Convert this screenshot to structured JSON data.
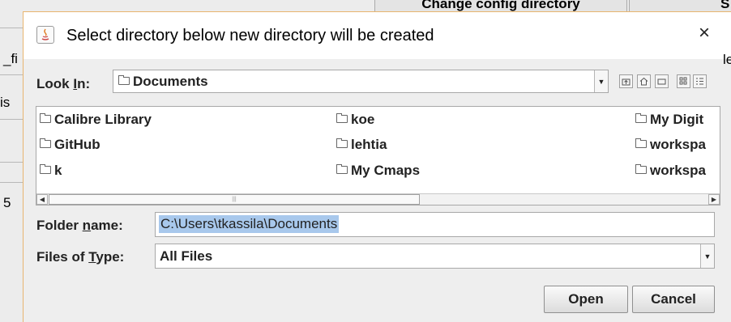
{
  "background": {
    "top_button_label": "Change config directory",
    "top_right_text": "S",
    "left_fragments": [
      "_fi",
      "is",
      "5"
    ],
    "right_fragments": [
      "le",
      "e"
    ]
  },
  "dialog": {
    "title": "Select directory below new directory will be created",
    "close_glyph": "×",
    "look_in_label_pre": "Look ",
    "look_in_label_mnemonic": "I",
    "look_in_label_post": "n:",
    "look_in_value": "Documents",
    "toolbar_icons": [
      "up-one-level-icon",
      "home-icon",
      "new-folder-icon",
      "list-view-icon",
      "details-view-icon"
    ],
    "files": [
      "Calibre Library",
      "GitHub",
      "k",
      "koe",
      "lehtia",
      "My Cmaps",
      "My Digit",
      "workspa",
      "workspa"
    ],
    "folder_name_label_pre": "Folder ",
    "folder_name_label_mnemonic": "n",
    "folder_name_label_post": "ame:",
    "folder_name_value": "C:\\Users\\tkassila\\Documents",
    "files_of_type_label_pre": "Files of ",
    "files_of_type_label_mnemonic": "T",
    "files_of_type_label_post": "ype:",
    "files_of_type_value": "All Files",
    "open_label": "Open",
    "cancel_label": "Cancel"
  },
  "colors": {
    "dialog_border": "#e8b56f",
    "selection": "#a8c8ec"
  }
}
